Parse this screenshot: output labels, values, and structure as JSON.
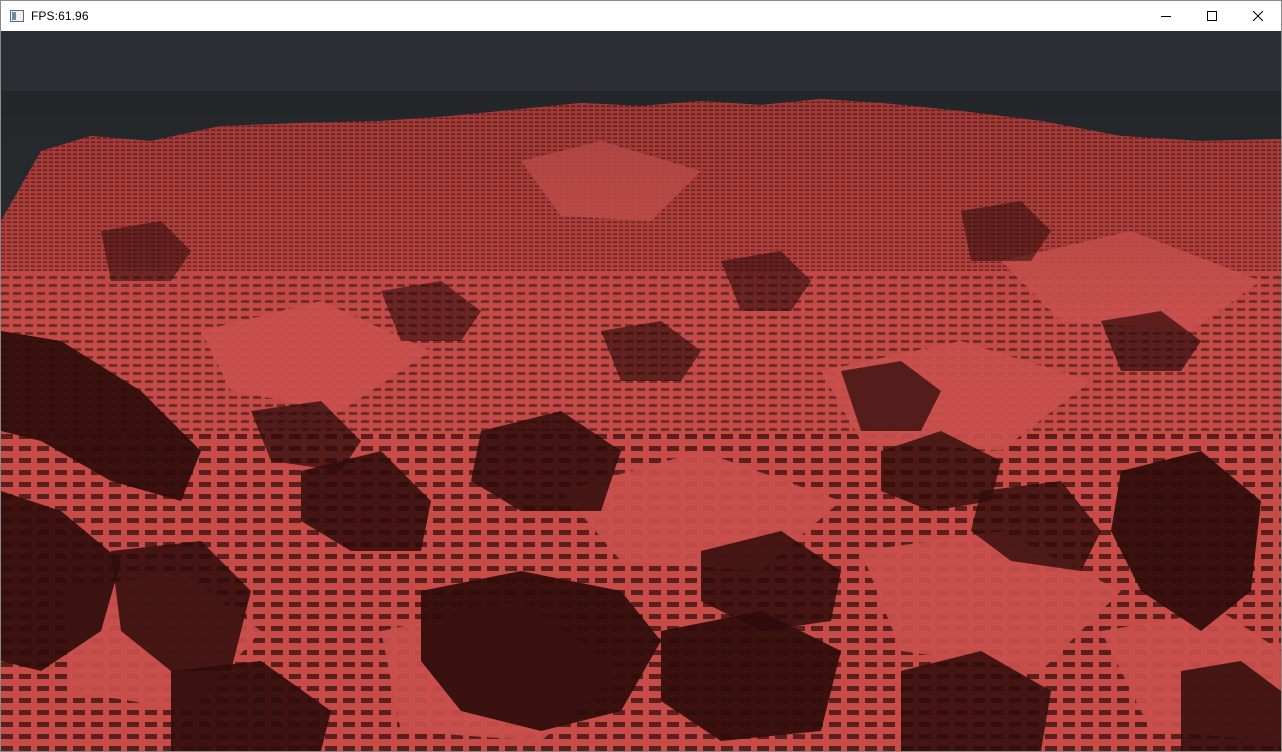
{
  "window": {
    "title": "FPS:61.96",
    "icon": "app-window-icon",
    "controls": {
      "minimize_icon": "minimize-icon",
      "maximize_icon": "maximize-icon",
      "close_icon": "close-icon"
    }
  },
  "scene": {
    "description_type": "voxel-terrain-render",
    "sky_color": "#2a2d31",
    "terrain_color": "#c24a47",
    "shadow_color": "#2e0c0b",
    "highlight_color": "#d25a55"
  }
}
